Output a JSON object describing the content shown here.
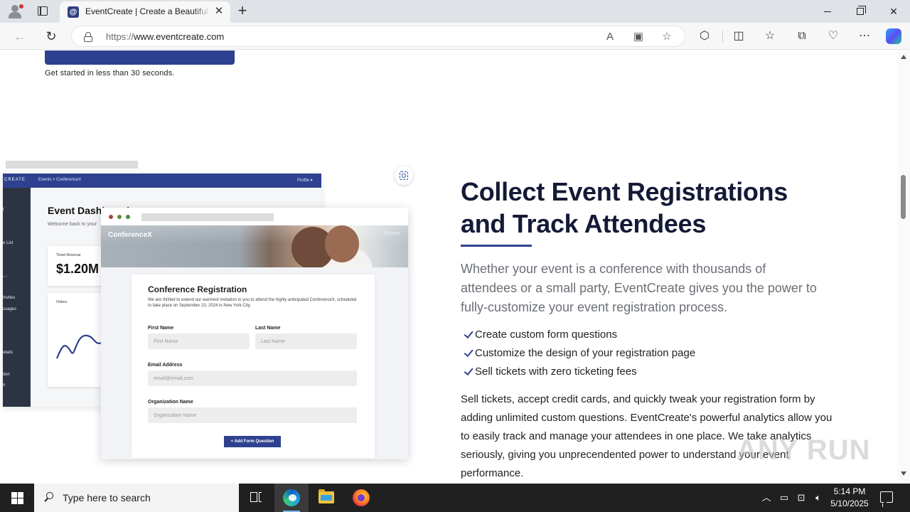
{
  "browser": {
    "tab_title": "EventCreate | Create a Beautiful E",
    "url_prefix": "https://",
    "url_host": "www.eventcreate.com",
    "window_controls": {
      "minimize": "minimize",
      "restore": "restore",
      "close": "✕"
    },
    "new_tab": "+",
    "close_tab": "✕"
  },
  "page": {
    "get_started": "Get started in less than 30 seconds.",
    "heading_line1": "Collect Event Registrations",
    "heading_line2": "and Track Attendees",
    "lead": "Whether your event is a conference with thousands of attendees or a small party, EventCreate gives you the power to fully-customize your event registration process.",
    "features": [
      "Create custom form questions",
      "Customize the design of your registration page",
      "Sell tickets with zero ticketing fees"
    ],
    "body": "Sell tickets, accept credit cards, and quickly tweak your registration form by adding unlimited custom questions. EventCreate's powerful analytics allow you to easily track and manage your attendees in one place. We take analytics seriously, giving you unprecendented power to understand your event performance.",
    "accent_color": "#2e4190"
  },
  "dashboard_mock": {
    "brand": "CREATE",
    "breadcrumb": "Events  >  ConferenceX",
    "profile": "Profile ▾",
    "title": "Event Dashboard",
    "welcome": "Welcome back to your",
    "ticket_revenue_label": "Ticket Revenue",
    "ticket_revenue_value": "$1.20M",
    "orders_label": "Orders",
    "sidebar_items": [
      "t",
      "e List",
      "ILS",
      "Invites",
      "ssages",
      "etails",
      "tion",
      "n"
    ]
  },
  "registration_mock": {
    "brand": "ConferenceX",
    "secure": "Secure",
    "form_title": "Conference Registration",
    "form_desc": "We are thrilled to extend our warmest invitation to you to attend the highly anticipated ConferenceX, scheduled to take place on September 23, 2024 in New York City.",
    "first_name_label": "First Name",
    "first_name_placeholder": "First Name",
    "last_name_label": "Last Name",
    "last_name_placeholder": "Last Name",
    "email_label": "Email Address",
    "email_placeholder": "email@email.com",
    "org_label": "Organization Name",
    "org_placeholder": "Organization Name",
    "add_question": "+ Add Form Question"
  },
  "taskbar": {
    "search_placeholder": "Type here to search",
    "time": "5:14 PM",
    "date": "5/10/2025"
  },
  "watermark": "ANY RUN"
}
